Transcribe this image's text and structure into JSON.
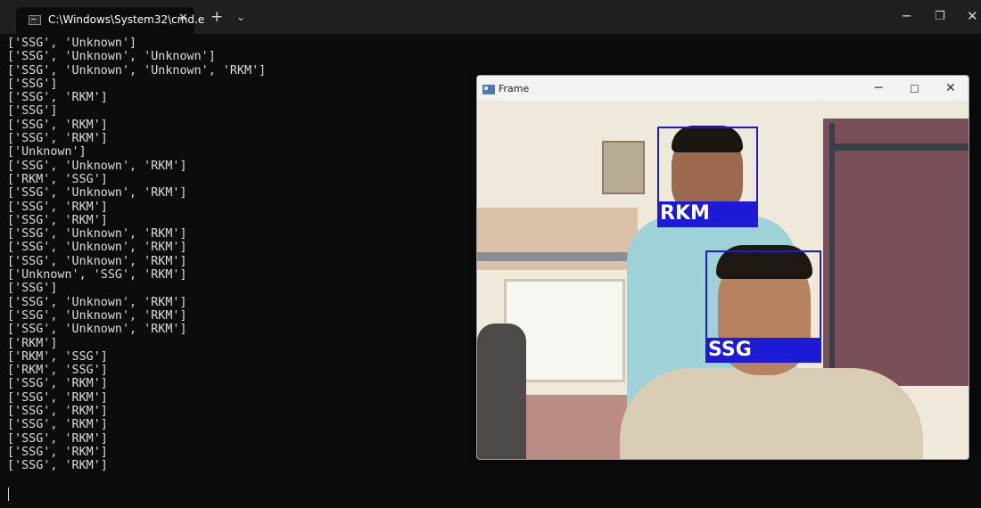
{
  "terminal": {
    "tab_title": "C:\\Windows\\System32\\cmd.e",
    "close_tab_glyph": "✕",
    "new_tab_glyph": "+",
    "dropdown_glyph": "⌄",
    "controls": {
      "minimize": "─",
      "maximize": "❐",
      "close": "✕"
    },
    "output_lines": [
      "['SSG', 'Unknown']",
      "['SSG', 'Unknown', 'Unknown']",
      "['SSG', 'Unknown', 'Unknown', 'RKM']",
      "['SSG']",
      "['SSG', 'RKM']",
      "['SSG']",
      "['SSG', 'RKM']",
      "['SSG', 'RKM']",
      "['Unknown']",
      "['SSG', 'Unknown', 'RKM']",
      "['RKM', 'SSG']",
      "['SSG', 'Unknown', 'RKM']",
      "['SSG', 'RKM']",
      "['SSG', 'RKM']",
      "['SSG', 'Unknown', 'RKM']",
      "['SSG', 'Unknown', 'RKM']",
      "['SSG', 'Unknown', 'RKM']",
      "['Unknown', 'SSG', 'RKM']",
      "['SSG']",
      "['SSG', 'Unknown', 'RKM']",
      "['SSG', 'Unknown', 'RKM']",
      "['SSG', 'Unknown', 'RKM']",
      "['RKM']",
      "['RKM', 'SSG']",
      "['RKM', 'SSG']",
      "['SSG', 'RKM']",
      "['SSG', 'RKM']",
      "['SSG', 'RKM']",
      "['SSG', 'RKM']",
      "['SSG', 'RKM']",
      "['SSG', 'RKM']",
      "['SSG', 'RKM']"
    ]
  },
  "frame_window": {
    "title": "Frame",
    "controls": {
      "minimize": "─",
      "maximize": "☐",
      "close": "✕"
    },
    "detections": [
      {
        "label": "RKM"
      },
      {
        "label": "SSG"
      }
    ],
    "box_color": "#1d1ad6"
  }
}
